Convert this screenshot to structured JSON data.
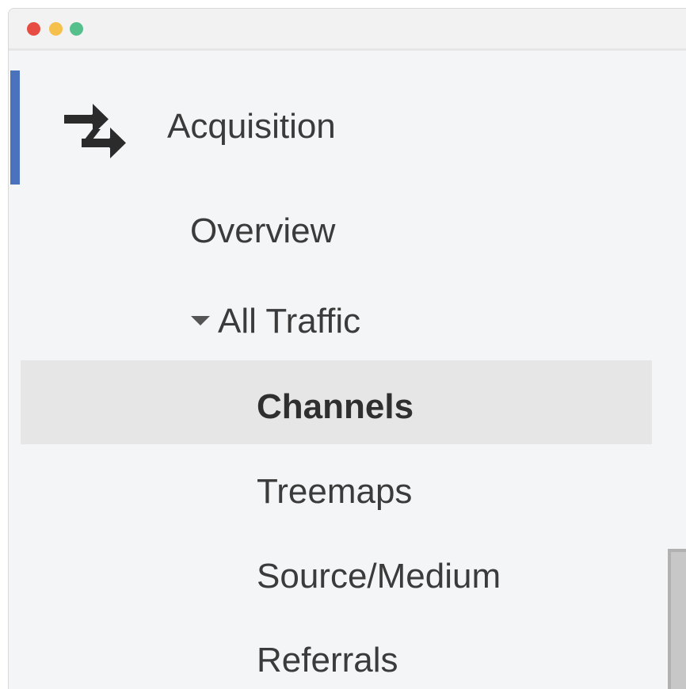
{
  "window": {
    "controls": [
      {
        "name": "close",
        "color": "#e74c43"
      },
      {
        "name": "minimize",
        "color": "#f6c04d"
      },
      {
        "name": "maximize",
        "color": "#56c08d"
      }
    ]
  },
  "nav": {
    "accent_color": "#4a72bd",
    "section": {
      "icon": "swap-arrows-icon",
      "title": "Acquisition"
    },
    "overview": "Overview",
    "all_traffic": {
      "label": "All Traffic",
      "expanded": true,
      "children": [
        {
          "label": "Channels",
          "selected": true
        },
        {
          "label": "Treemaps",
          "selected": false
        },
        {
          "label": "Source/Medium",
          "selected": false
        },
        {
          "label": "Referrals",
          "selected": false
        }
      ]
    }
  }
}
